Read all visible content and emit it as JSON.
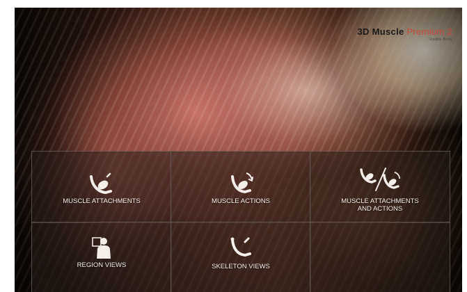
{
  "brand": {
    "title_main": "3D Muscle ",
    "title_highlight": "Premium 2",
    "subtitle": "Visible Body"
  },
  "menu": [
    {
      "label": "MUSCLE ATTACHMENTS",
      "icon": "muscle-arm-icon"
    },
    {
      "label": "MUSCLE ACTIONS",
      "icon": "muscle-rotate-icon"
    },
    {
      "label_line1": "MUSCLE ATTACHMENTS",
      "label_line2": "AND ACTIONS",
      "icon": "attachments-actions-icon"
    },
    {
      "label": "REGION VIEWS",
      "icon": "body-region-icon"
    },
    {
      "label": "SKELETON VIEWS",
      "icon": "bone-arm-icon"
    }
  ],
  "colors": {
    "accent": "#c9483a",
    "tile_bg": "#261e1a",
    "text": "#f3eeea"
  }
}
